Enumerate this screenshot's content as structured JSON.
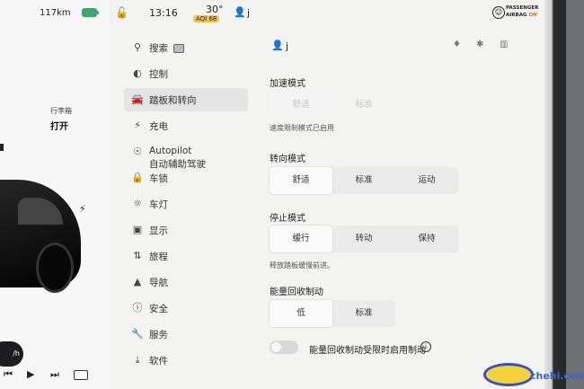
{
  "status": {
    "range": "117km",
    "time": "13:16",
    "temperature": "30°",
    "aqi": "AQI 68",
    "user": "j",
    "airbag_line1": "PASSENGER",
    "airbag_line2": "AIRBAG",
    "airbag_state": "ON"
  },
  "car_panel": {
    "trunk_label": "行李箱",
    "trunk_value": "打开",
    "speed_text": "/h"
  },
  "menu": {
    "items": [
      {
        "label": "搜索",
        "icon": "search-icon"
      },
      {
        "label": "控制",
        "icon": "toggle-icon"
      },
      {
        "label": "踏板和转向",
        "icon": "car-icon"
      },
      {
        "label": "充电",
        "icon": "bolt-icon"
      },
      {
        "label": "Autopilot",
        "label2": "自动辅助驾驶",
        "icon": "steering-wheel-icon"
      },
      {
        "label": "车锁",
        "icon": "lock-icon"
      },
      {
        "label": "车灯",
        "icon": "light-icon"
      },
      {
        "label": "显示",
        "icon": "display-icon"
      },
      {
        "label": "旅程",
        "icon": "trip-icon"
      },
      {
        "label": "导航",
        "icon": "navigation-icon"
      },
      {
        "label": "安全",
        "icon": "safety-icon"
      },
      {
        "label": "服务",
        "icon": "wrench-icon"
      },
      {
        "label": "软件",
        "icon": "download-icon"
      }
    ],
    "active": "踏板和转向"
  },
  "content": {
    "user": "j",
    "acceleration": {
      "title": "加速模式",
      "options": [
        "舒适",
        "标准"
      ],
      "selected": "舒适",
      "note": "速度限制模式已启用"
    },
    "steering": {
      "title": "转向模式",
      "options": [
        "舒适",
        "标准",
        "运动"
      ],
      "selected": "舒适"
    },
    "stopping": {
      "title": "停止模式",
      "options": [
        "缓行",
        "转动",
        "保持"
      ],
      "selected": "缓行",
      "note": "释放踏板缓慢前进。"
    },
    "regen": {
      "title": "能量回收制动",
      "options": [
        "低",
        "标准"
      ],
      "selected": "低"
    },
    "regen_toggle": {
      "label": "能量回收制动受限时启用制动",
      "on": false
    }
  },
  "watermark": {
    "text": "chehi.com"
  },
  "colors": {
    "battery": "#3aa76d",
    "aqi": "#f3c64b",
    "airbag_on": "#e2681d"
  }
}
